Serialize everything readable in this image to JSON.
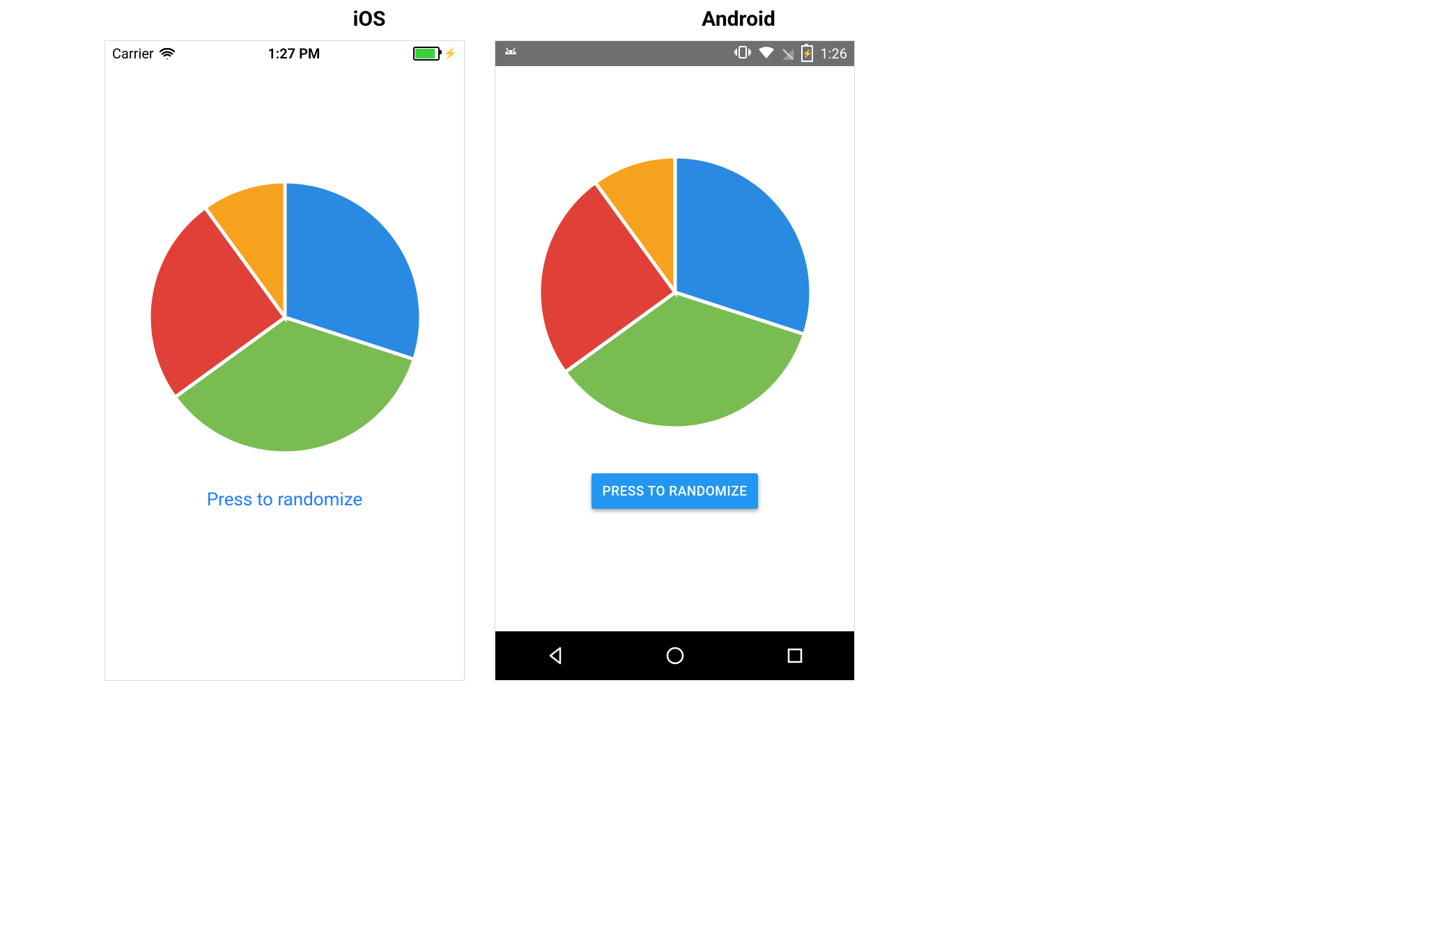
{
  "headings": {
    "ios": "iOS",
    "android": "Android"
  },
  "ios_status": {
    "carrier": "Carrier",
    "time": "1:27 PM"
  },
  "android_status": {
    "time": "1:26"
  },
  "buttons": {
    "ios_randomize": "Press to randomize",
    "android_randomize": "PRESS TO RANDOMIZE"
  },
  "colors": {
    "blue": "#2a8ae2",
    "green": "#78bc52",
    "red": "#e04038",
    "orange": "#f6a21e",
    "android_button_bg": "#2196f3",
    "ios_link": "#1e7cff",
    "android_statusbar": "#6f6f6f"
  },
  "chart_data": [
    {
      "platform": "ios",
      "type": "pie",
      "title": "",
      "series": [
        {
          "name": "blue",
          "value": 30,
          "color": "#2a8ae2"
        },
        {
          "name": "green",
          "value": 35,
          "color": "#78bc52"
        },
        {
          "name": "red",
          "value": 25,
          "color": "#e04038"
        },
        {
          "name": "orange",
          "value": 10,
          "color": "#f6a21e"
        }
      ]
    },
    {
      "platform": "android",
      "type": "pie",
      "title": "",
      "series": [
        {
          "name": "blue",
          "value": 30,
          "color": "#2a8ae2"
        },
        {
          "name": "green",
          "value": 35,
          "color": "#78bc52"
        },
        {
          "name": "red",
          "value": 25,
          "color": "#e04038"
        },
        {
          "name": "orange",
          "value": 10,
          "color": "#f6a21e"
        }
      ]
    }
  ]
}
